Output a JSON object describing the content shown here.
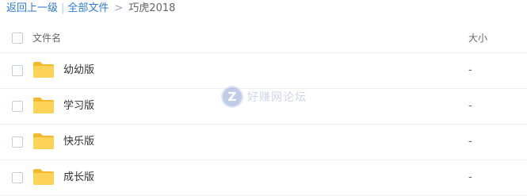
{
  "breadcrumb": {
    "back": "返回上一级",
    "separator": "|",
    "all_files": "全部文件",
    "arrow": ">",
    "current": "巧虎2018"
  },
  "table": {
    "headers": {
      "name": "文件名",
      "size": "大小"
    },
    "rows": [
      {
        "name": "幼幼版",
        "size": "-",
        "icon": "folder-icon"
      },
      {
        "name": "学习版",
        "size": "-",
        "icon": "folder-icon"
      },
      {
        "name": "快乐版",
        "size": "-",
        "icon": "folder-icon"
      },
      {
        "name": "成长版",
        "size": "-",
        "icon": "folder-icon"
      }
    ]
  },
  "watermark": {
    "logo": "Z",
    "text": "好赚网论坛"
  },
  "colors": {
    "link": "#2f7bd6",
    "folder_back": "#f2b92c",
    "folder_front": "#fcd257",
    "divider": "#eef0f4",
    "checkbox_border": "#c6cdd6"
  }
}
